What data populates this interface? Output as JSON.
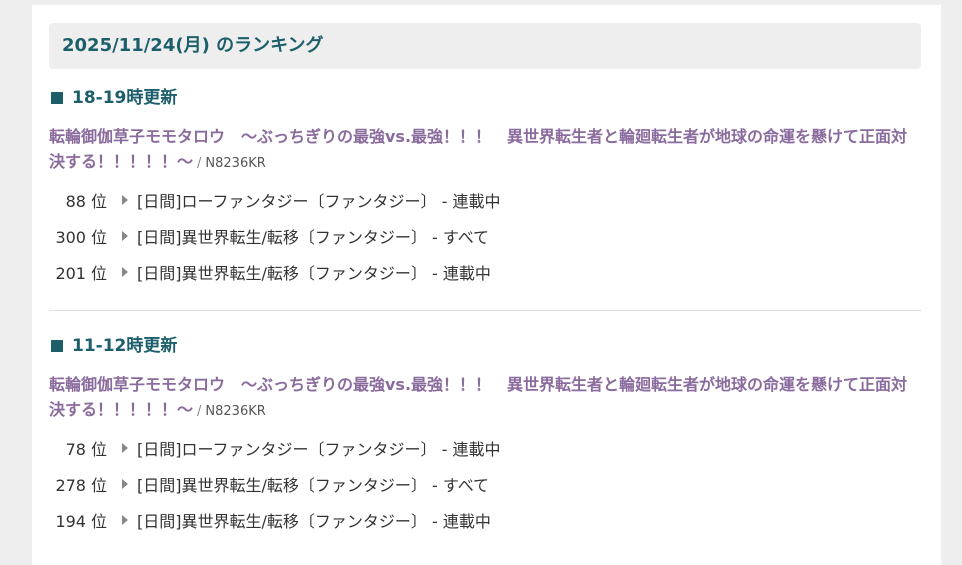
{
  "date_header": "2025/11/24(月) のランキング",
  "sections": [
    {
      "title": "18-19時更新",
      "novel_title": "転輪御伽草子モモタロウ　～ぶっちぎりの最強vs.最強！！！　異世界転生者と輪廻転生者が地球の命運を懸けて正面対決する！！！！！～",
      "separator": "/",
      "ncode": "N8236KR",
      "ranks": [
        {
          "rank": "88",
          "unit": "位",
          "genre": "[日間]ローファンタジー〔ファンタジー〕 - 連載中"
        },
        {
          "rank": "300",
          "unit": "位",
          "genre": "[日間]異世界転生/転移〔ファンタジー〕 - すべて"
        },
        {
          "rank": "201",
          "unit": "位",
          "genre": "[日間]異世界転生/転移〔ファンタジー〕 - 連載中"
        }
      ]
    },
    {
      "title": "11-12時更新",
      "novel_title": "転輪御伽草子モモタロウ　～ぶっちぎりの最強vs.最強！！！　異世界転生者と輪廻転生者が地球の命運を懸けて正面対決する！！！！！～",
      "separator": "/",
      "ncode": "N8236KR",
      "ranks": [
        {
          "rank": "78",
          "unit": "位",
          "genre": "[日間]ローファンタジー〔ファンタジー〕 - 連載中"
        },
        {
          "rank": "278",
          "unit": "位",
          "genre": "[日間]異世界転生/転移〔ファンタジー〕 - すべて"
        },
        {
          "rank": "194",
          "unit": "位",
          "genre": "[日間]異世界転生/転移〔ファンタジー〕 - 連載中"
        }
      ]
    }
  ],
  "icons": {
    "section_marker": "square-icon",
    "rank_marker": "triangle-right-icon"
  },
  "colors": {
    "heading": "#1c5f6b",
    "novel_link": "#8a6b9d"
  }
}
